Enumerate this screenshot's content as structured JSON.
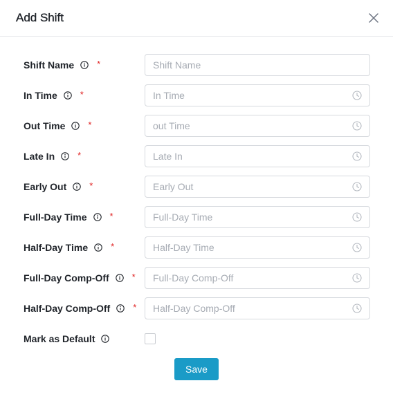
{
  "dialog": {
    "title": "Add Shift",
    "close_icon": "close-icon"
  },
  "fields": [
    {
      "label": "Shift Name",
      "placeholder": "Shift Name",
      "required": "*",
      "icon": "none"
    },
    {
      "label": "In Time",
      "placeholder": "In Time",
      "required": "*",
      "icon": "clock-icon"
    },
    {
      "label": "Out Time",
      "placeholder": "out Time",
      "required": "*",
      "icon": "clock-icon"
    },
    {
      "label": "Late In",
      "placeholder": "Late In",
      "required": "*",
      "icon": "clock-icon"
    },
    {
      "label": "Early Out",
      "placeholder": "Early Out",
      "required": "*",
      "icon": "clock-icon"
    },
    {
      "label": "Full-Day Time",
      "placeholder": "Full-Day Time",
      "required": "*",
      "icon": "clock-icon"
    },
    {
      "label": "Half-Day Time",
      "placeholder": "Half-Day Time",
      "required": "*",
      "icon": "clock-icon"
    },
    {
      "label": "Full-Day Comp-Off",
      "placeholder": "Full-Day Comp-Off",
      "required": "*",
      "icon": "clock-icon"
    },
    {
      "label": "Half-Day Comp-Off",
      "placeholder": "Half-Day Comp-Off",
      "required": "*",
      "icon": "clock-icon"
    }
  ],
  "default_option": {
    "label": "Mark as Default",
    "checked": false
  },
  "actions": {
    "save_label": "Save"
  },
  "colors": {
    "accent": "#1a9bc7",
    "required": "#e02424",
    "placeholder": "#a6abb3",
    "border": "#d6d9de"
  }
}
